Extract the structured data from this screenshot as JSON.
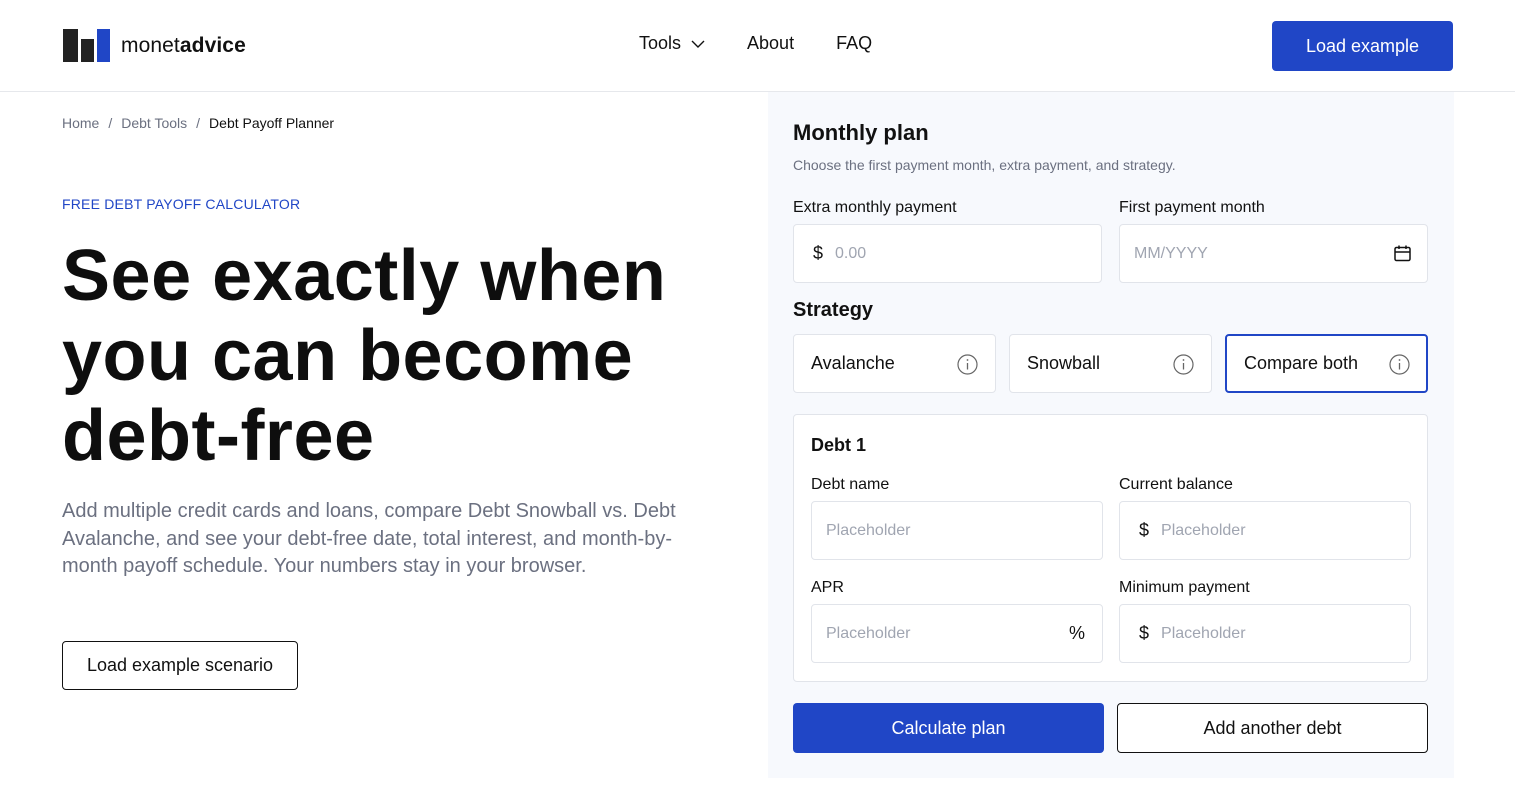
{
  "brand": {
    "name_regular": "monet",
    "name_bold": "advice"
  },
  "nav": {
    "items": [
      {
        "label": "Tools",
        "icon": "chevron-down-icon"
      },
      {
        "label": "About"
      },
      {
        "label": "FAQ"
      }
    ],
    "cta_label": "Load example"
  },
  "breadcrumb": {
    "items": [
      "Home",
      "Debt Tools",
      "Debt Payoff Planner"
    ],
    "separator": "/"
  },
  "hero": {
    "eyebrow": "FREE DEBT PAYOFF CALCULATOR",
    "title": "See exactly when you can become debt-free",
    "lead": "Add multiple credit cards and loans, compare Debt Snowball vs. Debt Avalanche, and see your debt-free date, total interest, and month-by-month payoff schedule. Your numbers stay in your browser.",
    "button_label": "Load example scenario"
  },
  "plan": {
    "title": "Monthly plan",
    "subtitle": "Choose the first payment month, extra payment, and strategy.",
    "extra_payment": {
      "label": "Extra monthly payment",
      "prefix": "$",
      "placeholder": "0.00",
      "value": ""
    },
    "first_month": {
      "label": "First payment month",
      "placeholder": "MM/YYYY",
      "value": "",
      "icon": "calendar-icon"
    },
    "strategy": {
      "label": "Strategy",
      "options": [
        {
          "label": "Avalanche",
          "selected": false
        },
        {
          "label": "Snowball",
          "selected": false
        },
        {
          "label": "Compare both",
          "selected": true
        }
      ],
      "info_icon": "info-icon"
    },
    "debt": {
      "title": "Debt 1",
      "name": {
        "label": "Debt name",
        "placeholder": "Placeholder"
      },
      "balance": {
        "label": "Current balance",
        "prefix": "$",
        "placeholder": "Placeholder"
      },
      "apr": {
        "label": "APR",
        "suffix": "%",
        "placeholder": "Placeholder"
      },
      "minimum": {
        "label": "Minimum payment",
        "prefix": "$",
        "placeholder": "Placeholder"
      }
    },
    "calculate_label": "Calculate plan",
    "add_debt_label": "Add another debt"
  },
  "colors": {
    "accent": "#2046c6",
    "muted_text": "#6b7080",
    "panel_bg": "#f7f9fd",
    "border": "#e1e4ea"
  }
}
